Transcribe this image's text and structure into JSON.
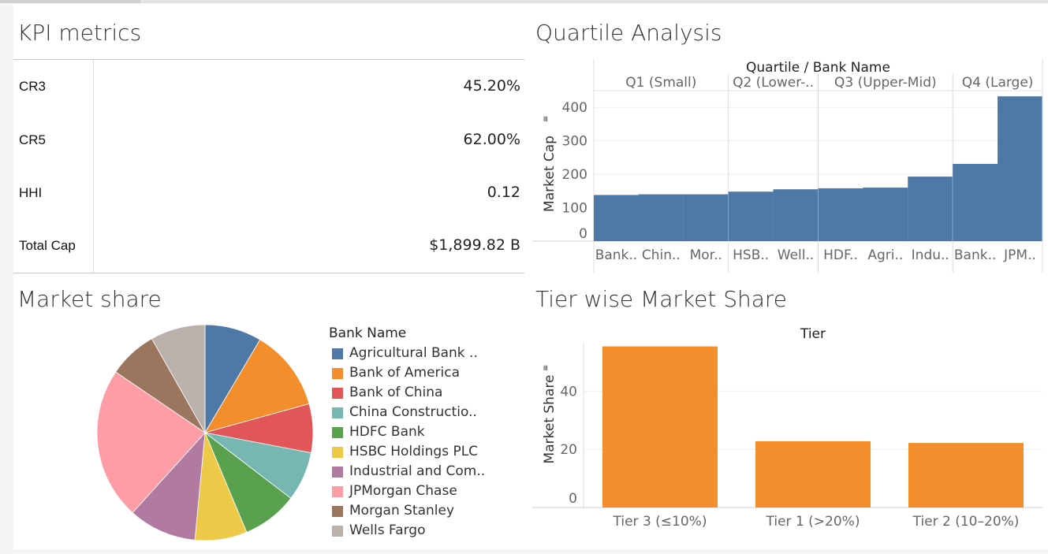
{
  "kpi": {
    "title": "KPI metrics",
    "rows": [
      {
        "label": "CR3",
        "value": "45.20%"
      },
      {
        "label": "CR5",
        "value": "62.00%"
      },
      {
        "label": "HHI",
        "value": "0.12"
      },
      {
        "label": "Total Cap",
        "value": "$1,899.82 B"
      }
    ]
  },
  "quartile": {
    "title": "Quartile Analysis"
  },
  "market": {
    "title": "Market share"
  },
  "tier": {
    "title": "Tier wise Market Share"
  },
  "chart_data": [
    {
      "type": "bar",
      "title": "Quartile Analysis",
      "header": "Quartile  /  Bank Name",
      "ylabel": "Market Cap",
      "ylim": [
        0,
        450
      ],
      "yticks": [
        0,
        100,
        200,
        300,
        400
      ],
      "color": "#4e79a7",
      "groups": [
        {
          "label": "Q1 (Small)",
          "bars": [
            {
              "label": "Bank..",
              "value": 138
            },
            {
              "label": "Chin..",
              "value": 140
            },
            {
              "label": "Mor..",
              "value": 140
            }
          ]
        },
        {
          "label": "Q2 (Lower-..",
          "bars": [
            {
              "label": "HSB..",
              "value": 148
            },
            {
              "label": "Well..",
              "value": 155
            }
          ]
        },
        {
          "label": "Q3 (Upper-Mid)",
          "bars": [
            {
              "label": "HDF..",
              "value": 158
            },
            {
              "label": "Agri..",
              "value": 160
            },
            {
              "label": "Indu..",
              "value": 193
            }
          ]
        },
        {
          "label": "Q4 (Large)",
          "bars": [
            {
              "label": "Bank..",
              "value": 231
            },
            {
              "label": "JPM..",
              "value": 433
            }
          ]
        }
      ]
    },
    {
      "type": "pie",
      "title": "Market share",
      "legend_title": "Bank Name",
      "slices": [
        {
          "label": "Agricultural Bank ..",
          "value": 8.5,
          "color": "#4e79a7"
        },
        {
          "label": "Bank of America",
          "value": 12.2,
          "color": "#f28e2b"
        },
        {
          "label": "Bank of China",
          "value": 7.3,
          "color": "#e15759"
        },
        {
          "label": "China Constructio..",
          "value": 7.4,
          "color": "#76b7b2"
        },
        {
          "label": "HDFC Bank",
          "value": 8.3,
          "color": "#59a14f"
        },
        {
          "label": "HSBC Holdings PLC",
          "value": 7.8,
          "color": "#edc948"
        },
        {
          "label": "Industrial and Com..",
          "value": 10.2,
          "color": "#b07aa1"
        },
        {
          "label": "JPMorgan Chase",
          "value": 22.8,
          "color": "#ff9da7"
        },
        {
          "label": "Morgan Stanley",
          "value": 7.3,
          "color": "#9c755f"
        },
        {
          "label": "Wells Fargo",
          "value": 8.2,
          "color": "#bab0ac"
        }
      ]
    },
    {
      "type": "bar",
      "title": "Tier wise Market Share",
      "header": "Tier",
      "ylabel": "Market Share",
      "ylim": [
        0,
        58
      ],
      "yticks": [
        0,
        20,
        40
      ],
      "color": "#f28e2b",
      "categories": [
        "Tier 3 (≤10%)",
        "Tier 1 (>20%)",
        "Tier 2 (10–20%)"
      ],
      "values": [
        55.4,
        22.8,
        22.2
      ]
    }
  ]
}
